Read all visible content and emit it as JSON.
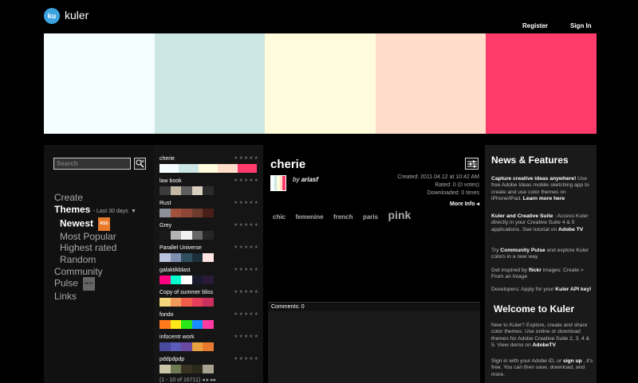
{
  "header": {
    "logo_badge": "ku",
    "logo_text": "kuler",
    "register": "Register",
    "signin": "Sign In"
  },
  "hero_colors": [
    "#F5FEFF",
    "#CCE6E3",
    "#FFFBDB",
    "#FFDDCA",
    "#FF3B6B"
  ],
  "sidebar": {
    "search_placeholder": "Search",
    "create": "Create",
    "themes": "Themes",
    "themes_suffix": "- Last 30 days",
    "newest": "Newest",
    "rss": "RSS",
    "most_popular": "Most Popular",
    "highest_rated": "Highest rated",
    "random": "Random",
    "community": "Community",
    "pulse": "Pulse",
    "beta": "BETA",
    "links": "Links"
  },
  "themes": [
    {
      "name": "cherie",
      "colors": [
        "#F5FEFF",
        "#CCE6E3",
        "#FFFBDB",
        "#FFDDCA",
        "#FF3B6B"
      ]
    },
    {
      "name": "law book",
      "colors": [
        "#3B3B3B",
        "#C4B8A4",
        "#5E5E5E",
        "#D9CFC0",
        "#2A2A2A"
      ]
    },
    {
      "name": "Rust",
      "colors": [
        "#8C9199",
        "#A0523D",
        "#8E4636",
        "#6E3B2F",
        "#4A1F1A"
      ]
    },
    {
      "name": "Grey",
      "colors": [
        "#1A1A1A",
        "#B3B3B3",
        "#F2F2F2",
        "#666666",
        "#262626"
      ]
    },
    {
      "name": "Parallel Universe",
      "colors": [
        "#B8C2DE",
        "#7E8FB0",
        "#2F4F5C",
        "#1B2F3A",
        "#FFE4E1"
      ]
    },
    {
      "name": "galaktikblast",
      "colors": [
        "#FF0080",
        "#00FFCC",
        "#FFFFFF",
        "#1A1A2E",
        "#2A1A3A"
      ]
    },
    {
      "name": "Copy of summer bliss",
      "colors": [
        "#F6D67A",
        "#F29A5B",
        "#F05E4B",
        "#E53E5A",
        "#C9305B"
      ]
    },
    {
      "name": "fondo",
      "colors": [
        "#FF7A1A",
        "#FFE81A",
        "#2AE81A",
        "#1A8AFF",
        "#FF3AA0"
      ]
    },
    {
      "name": "infocentr work",
      "colors": [
        "#4A4A9E",
        "#5B5BB8",
        "#6A4AA0",
        "#E8A040",
        "#E87A30"
      ]
    },
    {
      "name": "pddpdpdp",
      "colors": [
        "#C9C7A8",
        "#6E7A52",
        "#3A3324",
        "#2A2A1A",
        "#A8A390"
      ]
    }
  ],
  "pager": "(1 - 10 of 16711)",
  "detail": {
    "title": "cherie",
    "by_prefix": "by",
    "author": "ariasf",
    "created": "Created: 2011.04.12 at 10:42 AM",
    "rated": "Rated: 0 (0 votes)",
    "downloaded": "Downloaded: 0 times",
    "more_info": "More Info",
    "tags": [
      "chic",
      "femenine",
      "french",
      "paris",
      "pink"
    ],
    "comments": "Comments: 0"
  },
  "news": {
    "heading": "News & Features",
    "p1_bold": "Capture creative ideas anywhere!",
    "p1_text": "Use free Adobe Ideas mobile sketching app to create and use color themes on iPhone/iPad.",
    "p1_link": "Learn more here",
    "p2_bold": "Kuler and Creative Suite",
    "p2_text": ": Access Kuler directly in your Creative Suite 4 & 5 applications. See tutorial on",
    "p2_link": "Adobe TV",
    "p3_pre": "Try",
    "p3_link": "Community Pulse",
    "p3_text": "and explore Kuler colors in a new way",
    "p4_pre": "Get inspired by",
    "p4_link": "flickr",
    "p4_text": "images: Create > From an Image",
    "p5_pre": "Developers: Apply for your",
    "p5_link": "Kuler API key!",
    "welcome_heading": "Welcome to Kuler",
    "p6_text": "New to Kuler? Explore, create and share color themes. Use online or download themes for Adobe Creative Suite 2, 3, 4 & 5. View demo on",
    "p6_link": "AdobeTV",
    "p7_pre": "Sign in with your Adobe ID, or",
    "p7_link": "sign up",
    "p7_text": ", it's free. You can then save, download, and more."
  },
  "stars": "★★★★★"
}
